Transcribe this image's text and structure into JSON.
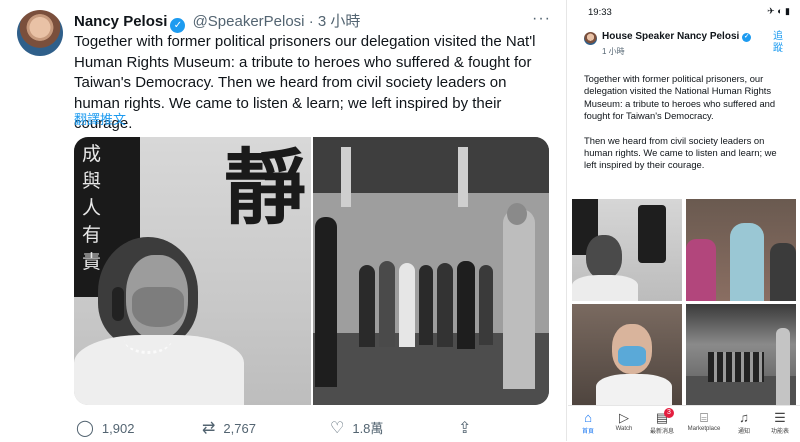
{
  "tweet": {
    "name": "Nancy Pelosi",
    "verified_mark": "✓",
    "handle": "@SpeakerPelosi",
    "separator": "·",
    "time": "3 小時",
    "more": "···",
    "text": "Together with former political prisoners our delegation visited the Nat'l Human Rights Museum: a tribute to heroes who suffered & fought for Taiwan's Democracy. Then we heard from civil society leaders on human rights. We came to listen & learn; we left inspired by their courage.",
    "translate": "翻譯推文",
    "photo1_calligraphy": [
      "成",
      "與",
      "人",
      "有",
      "責"
    ],
    "photo1_large_char": "靜",
    "reply_count": "1,902",
    "retweet_count": "2,767",
    "like_count": "1.8萬"
  },
  "phone": {
    "status_time": "19:33",
    "status_icons": "✈ ◐ ▮",
    "name": "House Speaker Nancy Pelosi",
    "verified_mark": "✓",
    "follow": "追蹤",
    "time": "1 小時",
    "text_p1": "Together with former political prisoners, our delegation visited the National Human Rights Museum: a tribute to heroes who suffered and fought for Taiwan's Democracy.",
    "text_p2": "Then we heard from civil society leaders on human rights. We came to listen and learn; we left inspired by their courage.",
    "badge": "3",
    "tabs": [
      "首頁",
      "Watch",
      "最新消息",
      "Marketplace",
      "通知",
      "功能表"
    ]
  },
  "colors": {
    "accent": "#1d9bf0",
    "muted": "#536471",
    "text": "#0f1419",
    "notify": "#e41e3f"
  },
  "icons": [
    "verified-badge-icon",
    "more-icon",
    "reply-icon",
    "retweet-icon",
    "like-icon",
    "share-icon",
    "home-icon",
    "watch-icon",
    "news-icon",
    "marketplace-icon",
    "bell-icon",
    "menu-icon"
  ]
}
